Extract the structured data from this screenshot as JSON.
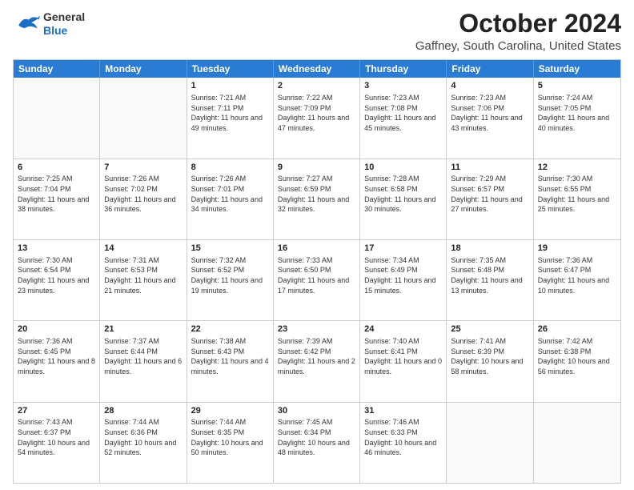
{
  "header": {
    "logo_general": "General",
    "logo_blue": "Blue",
    "title": "October 2024",
    "subtitle": "Gaffney, South Carolina, United States"
  },
  "days_of_week": [
    "Sunday",
    "Monday",
    "Tuesday",
    "Wednesday",
    "Thursday",
    "Friday",
    "Saturday"
  ],
  "weeks": [
    [
      {
        "day": "",
        "content": ""
      },
      {
        "day": "",
        "content": ""
      },
      {
        "day": "1",
        "content": "Sunrise: 7:21 AM\nSunset: 7:11 PM\nDaylight: 11 hours and 49 minutes."
      },
      {
        "day": "2",
        "content": "Sunrise: 7:22 AM\nSunset: 7:09 PM\nDaylight: 11 hours and 47 minutes."
      },
      {
        "day": "3",
        "content": "Sunrise: 7:23 AM\nSunset: 7:08 PM\nDaylight: 11 hours and 45 minutes."
      },
      {
        "day": "4",
        "content": "Sunrise: 7:23 AM\nSunset: 7:06 PM\nDaylight: 11 hours and 43 minutes."
      },
      {
        "day": "5",
        "content": "Sunrise: 7:24 AM\nSunset: 7:05 PM\nDaylight: 11 hours and 40 minutes."
      }
    ],
    [
      {
        "day": "6",
        "content": "Sunrise: 7:25 AM\nSunset: 7:04 PM\nDaylight: 11 hours and 38 minutes."
      },
      {
        "day": "7",
        "content": "Sunrise: 7:26 AM\nSunset: 7:02 PM\nDaylight: 11 hours and 36 minutes."
      },
      {
        "day": "8",
        "content": "Sunrise: 7:26 AM\nSunset: 7:01 PM\nDaylight: 11 hours and 34 minutes."
      },
      {
        "day": "9",
        "content": "Sunrise: 7:27 AM\nSunset: 6:59 PM\nDaylight: 11 hours and 32 minutes."
      },
      {
        "day": "10",
        "content": "Sunrise: 7:28 AM\nSunset: 6:58 PM\nDaylight: 11 hours and 30 minutes."
      },
      {
        "day": "11",
        "content": "Sunrise: 7:29 AM\nSunset: 6:57 PM\nDaylight: 11 hours and 27 minutes."
      },
      {
        "day": "12",
        "content": "Sunrise: 7:30 AM\nSunset: 6:55 PM\nDaylight: 11 hours and 25 minutes."
      }
    ],
    [
      {
        "day": "13",
        "content": "Sunrise: 7:30 AM\nSunset: 6:54 PM\nDaylight: 11 hours and 23 minutes."
      },
      {
        "day": "14",
        "content": "Sunrise: 7:31 AM\nSunset: 6:53 PM\nDaylight: 11 hours and 21 minutes."
      },
      {
        "day": "15",
        "content": "Sunrise: 7:32 AM\nSunset: 6:52 PM\nDaylight: 11 hours and 19 minutes."
      },
      {
        "day": "16",
        "content": "Sunrise: 7:33 AM\nSunset: 6:50 PM\nDaylight: 11 hours and 17 minutes."
      },
      {
        "day": "17",
        "content": "Sunrise: 7:34 AM\nSunset: 6:49 PM\nDaylight: 11 hours and 15 minutes."
      },
      {
        "day": "18",
        "content": "Sunrise: 7:35 AM\nSunset: 6:48 PM\nDaylight: 11 hours and 13 minutes."
      },
      {
        "day": "19",
        "content": "Sunrise: 7:36 AM\nSunset: 6:47 PM\nDaylight: 11 hours and 10 minutes."
      }
    ],
    [
      {
        "day": "20",
        "content": "Sunrise: 7:36 AM\nSunset: 6:45 PM\nDaylight: 11 hours and 8 minutes."
      },
      {
        "day": "21",
        "content": "Sunrise: 7:37 AM\nSunset: 6:44 PM\nDaylight: 11 hours and 6 minutes."
      },
      {
        "day": "22",
        "content": "Sunrise: 7:38 AM\nSunset: 6:43 PM\nDaylight: 11 hours and 4 minutes."
      },
      {
        "day": "23",
        "content": "Sunrise: 7:39 AM\nSunset: 6:42 PM\nDaylight: 11 hours and 2 minutes."
      },
      {
        "day": "24",
        "content": "Sunrise: 7:40 AM\nSunset: 6:41 PM\nDaylight: 11 hours and 0 minutes."
      },
      {
        "day": "25",
        "content": "Sunrise: 7:41 AM\nSunset: 6:39 PM\nDaylight: 10 hours and 58 minutes."
      },
      {
        "day": "26",
        "content": "Sunrise: 7:42 AM\nSunset: 6:38 PM\nDaylight: 10 hours and 56 minutes."
      }
    ],
    [
      {
        "day": "27",
        "content": "Sunrise: 7:43 AM\nSunset: 6:37 PM\nDaylight: 10 hours and 54 minutes."
      },
      {
        "day": "28",
        "content": "Sunrise: 7:44 AM\nSunset: 6:36 PM\nDaylight: 10 hours and 52 minutes."
      },
      {
        "day": "29",
        "content": "Sunrise: 7:44 AM\nSunset: 6:35 PM\nDaylight: 10 hours and 50 minutes."
      },
      {
        "day": "30",
        "content": "Sunrise: 7:45 AM\nSunset: 6:34 PM\nDaylight: 10 hours and 48 minutes."
      },
      {
        "day": "31",
        "content": "Sunrise: 7:46 AM\nSunset: 6:33 PM\nDaylight: 10 hours and 46 minutes."
      },
      {
        "day": "",
        "content": ""
      },
      {
        "day": "",
        "content": ""
      }
    ]
  ]
}
